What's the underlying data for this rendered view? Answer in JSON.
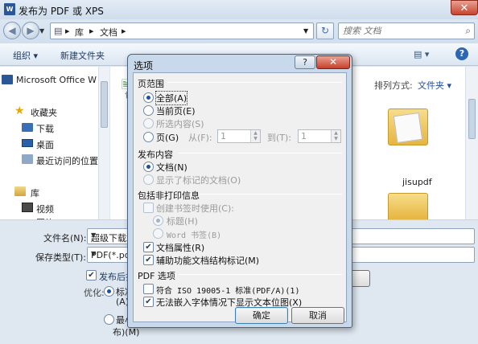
{
  "window": {
    "icon_text": "W",
    "title": "发布为 PDF 或 XPS",
    "close": "✕"
  },
  "address": {
    "back": "◀",
    "forward": "▶",
    "crumb_sep": "▸",
    "crumbs": [
      "库",
      "文档"
    ],
    "refresh": "↻",
    "search_placeholder": "搜索 文档",
    "search_icon": "⌕",
    "dropdown": "▼"
  },
  "toolbar": {
    "organize": "组织 ▾",
    "new_folder": "新建文件夹",
    "view_icon": "▤ ▾",
    "help_icon": "?",
    "sort_label": "排列方式:",
    "sort_value": "文件夹 ▾"
  },
  "nav": {
    "items": [
      "Microsoft Office W",
      "收藏夹",
      "下载",
      "桌面",
      "最近访问的位置",
      "库",
      "视频",
      "图片"
    ]
  },
  "content": {
    "folder_name": "jisupdf",
    "partial_label": "包"
  },
  "bottom": {
    "filename_label": "文件名(N):",
    "filename_value": "超级下载站",
    "filetype_label": "保存类型(T):",
    "filetype_value": "PDF(*.pdf",
    "open_after": "发布后打",
    "optimize_label": "优化:",
    "opt1": "标准",
    "opt1_b": "(A)",
    "opt2": "最小",
    "opt2_b": "布)(M)",
    "arrow": "▼"
  },
  "dialog": {
    "title": "选项",
    "help": "?",
    "close": "✕",
    "page_range": {
      "heading": "页范围",
      "all": "全部(A)",
      "current": "当前页(E)",
      "selection": "所选内容(S)",
      "pages": "页(G)",
      "from": "从(F):",
      "from_value": "1",
      "to": "到(T):",
      "to_value": "1"
    },
    "publish_what": {
      "heading": "发布内容",
      "document": "文档(N)",
      "markup": "显示了标记的文档(O)"
    },
    "non_print": {
      "heading": "包括非打印信息",
      "bookmarks": "创建书签时使用(C):",
      "headings": "标题(H)",
      "word_bookmarks": "Word 书签(B)",
      "doc_props": "文档属性(R)",
      "struct_tags": "辅助功能文档结构标记(M)"
    },
    "pdf_options": {
      "heading": "PDF 选项",
      "iso": "符合 ISO 19005-1 标准(PDF/A)(1)",
      "bitmap": "无法嵌入字体情况下显示文本位图(X)"
    },
    "ok": "确定",
    "cancel": "取消"
  }
}
